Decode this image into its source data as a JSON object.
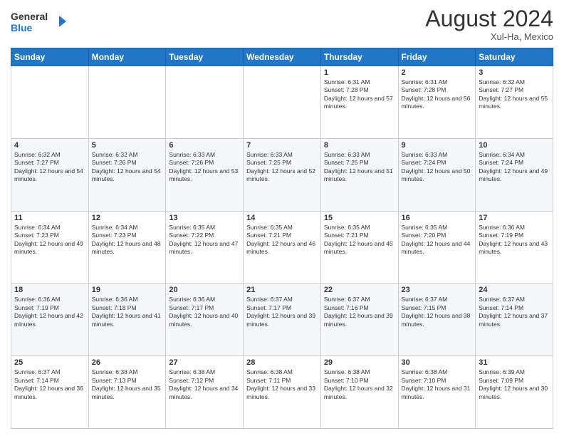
{
  "header": {
    "logo_line1": "General",
    "logo_line2": "Blue",
    "month_title": "August 2024",
    "location": "Xul-Ha, Mexico"
  },
  "days_of_week": [
    "Sunday",
    "Monday",
    "Tuesday",
    "Wednesday",
    "Thursday",
    "Friday",
    "Saturday"
  ],
  "weeks": [
    [
      {
        "day": "",
        "info": ""
      },
      {
        "day": "",
        "info": ""
      },
      {
        "day": "",
        "info": ""
      },
      {
        "day": "",
        "info": ""
      },
      {
        "day": "1",
        "info": "Sunrise: 6:31 AM\nSunset: 7:28 PM\nDaylight: 12 hours and 57 minutes."
      },
      {
        "day": "2",
        "info": "Sunrise: 6:31 AM\nSunset: 7:28 PM\nDaylight: 12 hours and 56 minutes."
      },
      {
        "day": "3",
        "info": "Sunrise: 6:32 AM\nSunset: 7:27 PM\nDaylight: 12 hours and 55 minutes."
      }
    ],
    [
      {
        "day": "4",
        "info": "Sunrise: 6:32 AM\nSunset: 7:27 PM\nDaylight: 12 hours and 54 minutes."
      },
      {
        "day": "5",
        "info": "Sunrise: 6:32 AM\nSunset: 7:26 PM\nDaylight: 12 hours and 54 minutes."
      },
      {
        "day": "6",
        "info": "Sunrise: 6:33 AM\nSunset: 7:26 PM\nDaylight: 12 hours and 53 minutes."
      },
      {
        "day": "7",
        "info": "Sunrise: 6:33 AM\nSunset: 7:25 PM\nDaylight: 12 hours and 52 minutes."
      },
      {
        "day": "8",
        "info": "Sunrise: 6:33 AM\nSunset: 7:25 PM\nDaylight: 12 hours and 51 minutes."
      },
      {
        "day": "9",
        "info": "Sunrise: 6:33 AM\nSunset: 7:24 PM\nDaylight: 12 hours and 50 minutes."
      },
      {
        "day": "10",
        "info": "Sunrise: 6:34 AM\nSunset: 7:24 PM\nDaylight: 12 hours and 49 minutes."
      }
    ],
    [
      {
        "day": "11",
        "info": "Sunrise: 6:34 AM\nSunset: 7:23 PM\nDaylight: 12 hours and 49 minutes."
      },
      {
        "day": "12",
        "info": "Sunrise: 6:34 AM\nSunset: 7:23 PM\nDaylight: 12 hours and 48 minutes."
      },
      {
        "day": "13",
        "info": "Sunrise: 6:35 AM\nSunset: 7:22 PM\nDaylight: 12 hours and 47 minutes."
      },
      {
        "day": "14",
        "info": "Sunrise: 6:35 AM\nSunset: 7:21 PM\nDaylight: 12 hours and 46 minutes."
      },
      {
        "day": "15",
        "info": "Sunrise: 6:35 AM\nSunset: 7:21 PM\nDaylight: 12 hours and 45 minutes."
      },
      {
        "day": "16",
        "info": "Sunrise: 6:35 AM\nSunset: 7:20 PM\nDaylight: 12 hours and 44 minutes."
      },
      {
        "day": "17",
        "info": "Sunrise: 6:36 AM\nSunset: 7:19 PM\nDaylight: 12 hours and 43 minutes."
      }
    ],
    [
      {
        "day": "18",
        "info": "Sunrise: 6:36 AM\nSunset: 7:19 PM\nDaylight: 12 hours and 42 minutes."
      },
      {
        "day": "19",
        "info": "Sunrise: 6:36 AM\nSunset: 7:18 PM\nDaylight: 12 hours and 41 minutes."
      },
      {
        "day": "20",
        "info": "Sunrise: 6:36 AM\nSunset: 7:17 PM\nDaylight: 12 hours and 40 minutes."
      },
      {
        "day": "21",
        "info": "Sunrise: 6:37 AM\nSunset: 7:17 PM\nDaylight: 12 hours and 39 minutes."
      },
      {
        "day": "22",
        "info": "Sunrise: 6:37 AM\nSunset: 7:16 PM\nDaylight: 12 hours and 39 minutes."
      },
      {
        "day": "23",
        "info": "Sunrise: 6:37 AM\nSunset: 7:15 PM\nDaylight: 12 hours and 38 minutes."
      },
      {
        "day": "24",
        "info": "Sunrise: 6:37 AM\nSunset: 7:14 PM\nDaylight: 12 hours and 37 minutes."
      }
    ],
    [
      {
        "day": "25",
        "info": "Sunrise: 6:37 AM\nSunset: 7:14 PM\nDaylight: 12 hours and 36 minutes."
      },
      {
        "day": "26",
        "info": "Sunrise: 6:38 AM\nSunset: 7:13 PM\nDaylight: 12 hours and 35 minutes."
      },
      {
        "day": "27",
        "info": "Sunrise: 6:38 AM\nSunset: 7:12 PM\nDaylight: 12 hours and 34 minutes."
      },
      {
        "day": "28",
        "info": "Sunrise: 6:38 AM\nSunset: 7:11 PM\nDaylight: 12 hours and 33 minutes."
      },
      {
        "day": "29",
        "info": "Sunrise: 6:38 AM\nSunset: 7:10 PM\nDaylight: 12 hours and 32 minutes."
      },
      {
        "day": "30",
        "info": "Sunrise: 6:38 AM\nSunset: 7:10 PM\nDaylight: 12 hours and 31 minutes."
      },
      {
        "day": "31",
        "info": "Sunrise: 6:39 AM\nSunset: 7:09 PM\nDaylight: 12 hours and 30 minutes."
      }
    ]
  ]
}
